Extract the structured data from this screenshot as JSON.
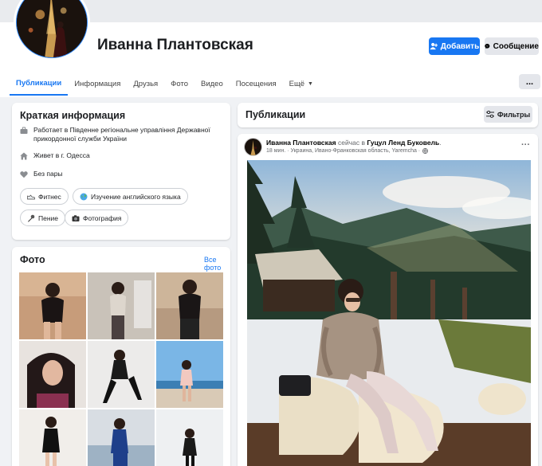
{
  "profile": {
    "name": "Иванна Плантовская"
  },
  "actions": {
    "add_label": "Добавить",
    "message_label": "Сообщение"
  },
  "tabs": [
    {
      "label": "Публикации",
      "active": true
    },
    {
      "label": "Информация"
    },
    {
      "label": "Друзья"
    },
    {
      "label": "Фото"
    },
    {
      "label": "Видео"
    },
    {
      "label": "Посещения"
    },
    {
      "label": "Ещё"
    }
  ],
  "more_button": "...",
  "intro": {
    "title": "Краткая информация",
    "work": "Работает в Південне регіональне управління Державної прикордонної служби України",
    "lives_prefix": "Живет в г. ",
    "lives_city": "Одесса",
    "relationship": "Без пары",
    "hobbies": [
      "Фитнес",
      "Изучение английского языка",
      "Пение",
      "Фотография"
    ]
  },
  "photos": {
    "title": "Фото",
    "all_link": "Все фото"
  },
  "posts": {
    "title": "Публикации",
    "filter_label": "Фильтры"
  },
  "post": {
    "author": "Иванна Плантовская",
    "action": " сейчас в ",
    "place": "Гуцул Ленд Буковель",
    "place_suffix": ".",
    "meta": "18 мин. · Украина, Ивано-Франковская область, Yaremcha ·",
    "menu": "···"
  },
  "colors": {
    "accent": "#1877f2",
    "background": "#f0f2f5",
    "button_gray": "#e4e6eb"
  },
  "icons": [
    "briefcase-icon",
    "home-icon",
    "heart-icon",
    "sneaker-icon",
    "globe-icon",
    "microphone-icon",
    "camera-icon",
    "sliders-icon",
    "messenger-icon",
    "add-friend-icon",
    "globe-small-icon"
  ]
}
